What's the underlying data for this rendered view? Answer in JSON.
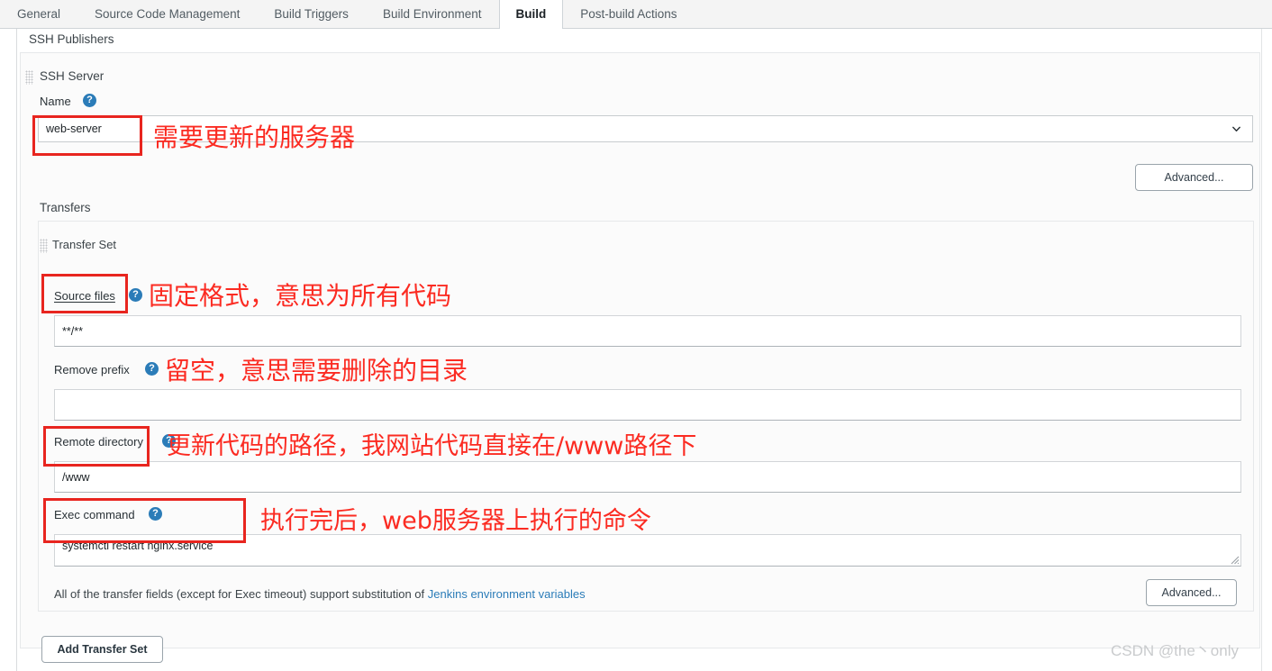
{
  "tabs": [
    {
      "label": "General",
      "active": false
    },
    {
      "label": "Source Code Management",
      "active": false
    },
    {
      "label": "Build Triggers",
      "active": false
    },
    {
      "label": "Build Environment",
      "active": false
    },
    {
      "label": "Build",
      "active": true
    },
    {
      "label": "Post-build Actions",
      "active": false
    }
  ],
  "section": {
    "title": "SSH Publishers"
  },
  "ssh_server": {
    "title": "SSH Server",
    "name_label": "Name",
    "name_help": "?",
    "name_value": "web-server",
    "advanced_label": "Advanced..."
  },
  "transfers": {
    "title": "Transfers",
    "transfer_set_title": "Transfer Set",
    "fields": [
      {
        "label": "Source files",
        "help": "?",
        "value": "**/**",
        "required": true
      },
      {
        "label": "Remove prefix",
        "help": "?",
        "value": "",
        "required": false
      },
      {
        "label": "Remote directory",
        "help": "?",
        "value": "/www",
        "required": false
      },
      {
        "label": "Exec command",
        "help": "?",
        "value": "systemctl restart nginx.service",
        "required": false
      }
    ],
    "note_prefix": "All of the transfer fields (except for Exec timeout) support substitution of ",
    "note_link": "Jenkins environment variables",
    "advanced_label": "Advanced...",
    "add_transfer_set_label": "Add Transfer Set"
  },
  "annotations": [
    {
      "text": "需要更新的服务器"
    },
    {
      "text": "固定格式，意思为所有代码"
    },
    {
      "text": "留空，意思需要删除的目录"
    },
    {
      "text": "更新代码的路径，我网站代码直接在/www路径下"
    },
    {
      "text": "执行完后，web服务器上执行的命令"
    }
  ],
  "watermark": {
    "text": "CSDN @the丶only"
  },
  "colors": {
    "accent": "#2b7cb8",
    "annotation": "#fb2b22",
    "tab_active_text": "#1c2226"
  }
}
